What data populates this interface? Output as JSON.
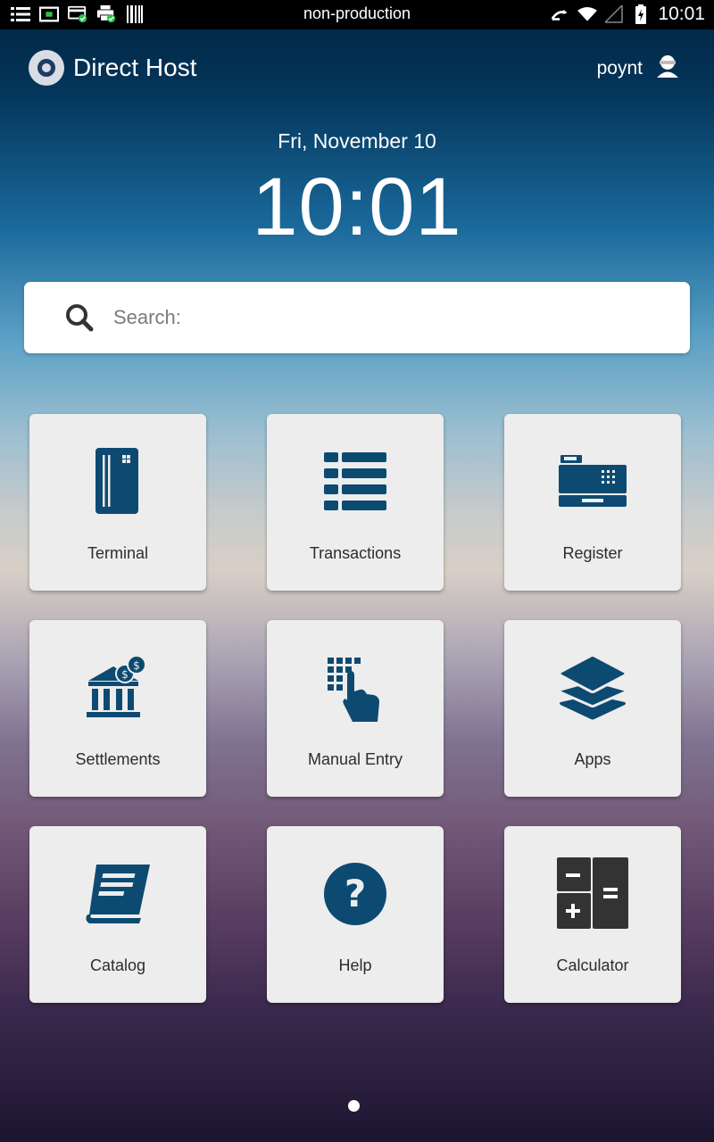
{
  "status_bar": {
    "environment": "non-production",
    "time": "10:01"
  },
  "header": {
    "app_title": "Direct Host",
    "user_name": "poynt"
  },
  "clock": {
    "date": "Fri, November 10",
    "time": "10:01"
  },
  "search": {
    "placeholder": "Search:"
  },
  "tiles": [
    {
      "label": "Terminal",
      "icon": "card-icon"
    },
    {
      "label": "Transactions",
      "icon": "list-icon"
    },
    {
      "label": "Register",
      "icon": "cash-register-icon"
    },
    {
      "label": "Settlements",
      "icon": "bank-icon"
    },
    {
      "label": "Manual Entry",
      "icon": "keypad-icon"
    },
    {
      "label": "Apps",
      "icon": "layers-icon"
    },
    {
      "label": "Catalog",
      "icon": "book-icon"
    },
    {
      "label": "Help",
      "icon": "help-icon"
    },
    {
      "label": "Calculator",
      "icon": "calculator-icon"
    }
  ],
  "colors": {
    "icon": "#0d4a72",
    "tile_bg": "#ededed",
    "status_bar": "#000000"
  }
}
